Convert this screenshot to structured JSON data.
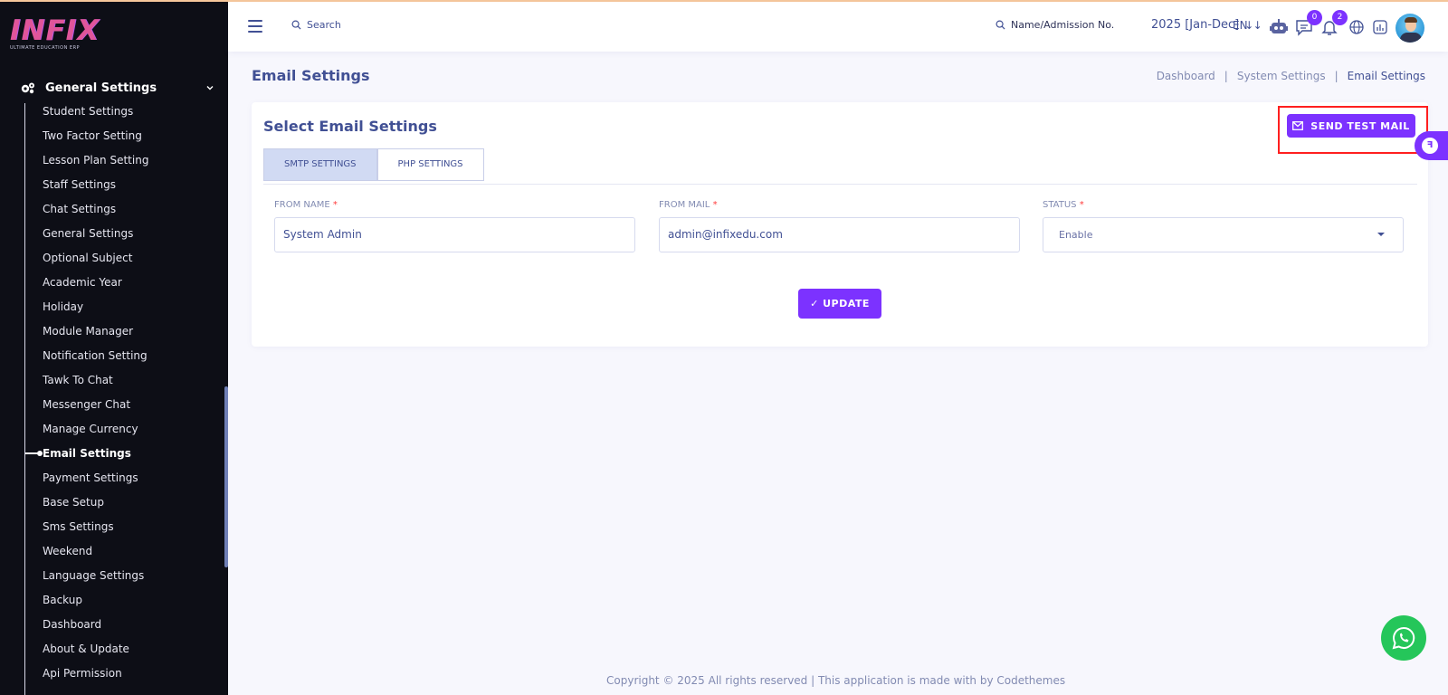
{
  "brand": {
    "logo_text": "INFIX",
    "logo_sub": "ULTIMATE EDUCATION ERP"
  },
  "sidebar": {
    "parent_label": "General Settings",
    "items": [
      {
        "label": "Student Settings"
      },
      {
        "label": "Two Factor Setting"
      },
      {
        "label": "Lesson Plan Setting"
      },
      {
        "label": "Staff Settings"
      },
      {
        "label": "Chat Settings"
      },
      {
        "label": "General Settings"
      },
      {
        "label": "Optional Subject"
      },
      {
        "label": "Academic Year"
      },
      {
        "label": "Holiday"
      },
      {
        "label": "Module Manager"
      },
      {
        "label": "Notification Setting"
      },
      {
        "label": "Tawk To Chat"
      },
      {
        "label": "Messenger Chat"
      },
      {
        "label": "Manage Currency"
      },
      {
        "label": "Email Settings"
      },
      {
        "label": "Payment Settings"
      },
      {
        "label": "Base Setup"
      },
      {
        "label": "Sms Settings"
      },
      {
        "label": "Weekend"
      },
      {
        "label": "Language Settings"
      },
      {
        "label": "Backup"
      },
      {
        "label": "Dashboard"
      },
      {
        "label": "About & Update"
      },
      {
        "label": "Api Permission"
      }
    ],
    "active_item": "Email Settings"
  },
  "topbar": {
    "search_label": "Search",
    "admission_search_label": "Name/Admission No.",
    "academic_year": "2025 [Jan-Dec]",
    "language": "EN",
    "chat_badge": "0",
    "notification_badge": "2"
  },
  "page": {
    "title": "Email Settings",
    "breadcrumb": [
      "Dashboard",
      "System Settings",
      "Email Settings"
    ]
  },
  "card": {
    "title": "Select Email Settings",
    "send_test_label": "SEND TEST MAIL",
    "tabs": [
      {
        "label": "SMTP SETTINGS",
        "active": true
      },
      {
        "label": "PHP SETTINGS",
        "active": false
      }
    ],
    "fields": {
      "from_name": {
        "label": "FROM NAME",
        "value": "System Admin"
      },
      "from_mail": {
        "label": "FROM MAIL",
        "value": "admin@infixedu.com"
      },
      "status": {
        "label": "STATUS",
        "value": "Enable"
      }
    },
    "required_mark": "*",
    "update_label": "✓ UPDATE"
  },
  "footer": {
    "text": "Copyright © 2025 All rights reserved | This application is made with by Codethemes"
  },
  "colors": {
    "accent": "#7c32ff",
    "sidebar_bg": "#0d0e16",
    "text": "#415094",
    "highlight": "#ff1f1f",
    "whatsapp": "#25c65a"
  }
}
